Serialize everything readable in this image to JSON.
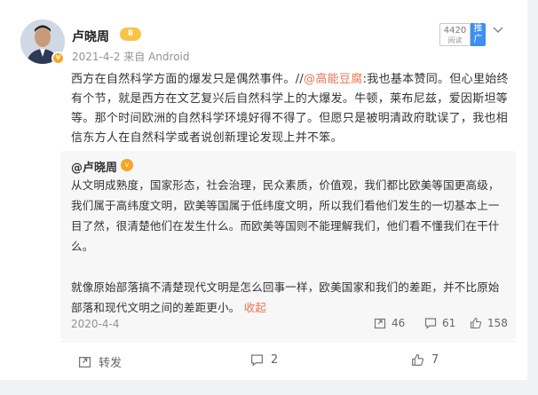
{
  "post": {
    "author": "卢晓周",
    "crown_badge": "Ⅱ",
    "verified_badge": "v",
    "date_source": "2021-4-2 来自 Android",
    "read_count": "4420",
    "read_label": "阅读",
    "promote_label": "推广",
    "text_before": "西方在自然科学方面的爆发只是偶然事件。//",
    "mention": "@高能豆腐",
    "text_after": ":我也基本赞同。但心里始终有个节，就是西方在文艺复兴后自然科学上的大爆发。牛顿，莱布尼兹，爱因斯坦等等。那个时间欧洲的自然科学环境好得不得了。但愿只是被明清政府耽误了，我也相信东方人在自然科学或者说创新理论发现上并不笨。"
  },
  "quoted": {
    "author": "@卢晓周",
    "badge": "v",
    "text_para1": "从文明成熟度，国家形态，社会治理，民众素质，价值观，我们都比欧美等国更高级，我们属于高纬度文明，欧美等国属于低纬度文明，所以我们看他们发生的一切基本上一目了然，很清楚他们在发生什么。而欧美等国则不能理解我们，他们看不懂我们在干什么。",
    "text_para2": "就像原始部落搞不清楚现代文明是怎么回事一样，欧美国家和我们的差距，并不比原始部落和现代文明之间的差距更小。",
    "fold_label": "收起",
    "date": "2020-4-4",
    "repost_count": "46",
    "comment_count": "61",
    "like_count": "158"
  },
  "actions": {
    "repost_label": "转发",
    "comment_count": "2",
    "like_count": "7"
  },
  "colors": {
    "accent": "#eb7350",
    "promote": "#3d8ff2",
    "verified": "#f5a623"
  }
}
